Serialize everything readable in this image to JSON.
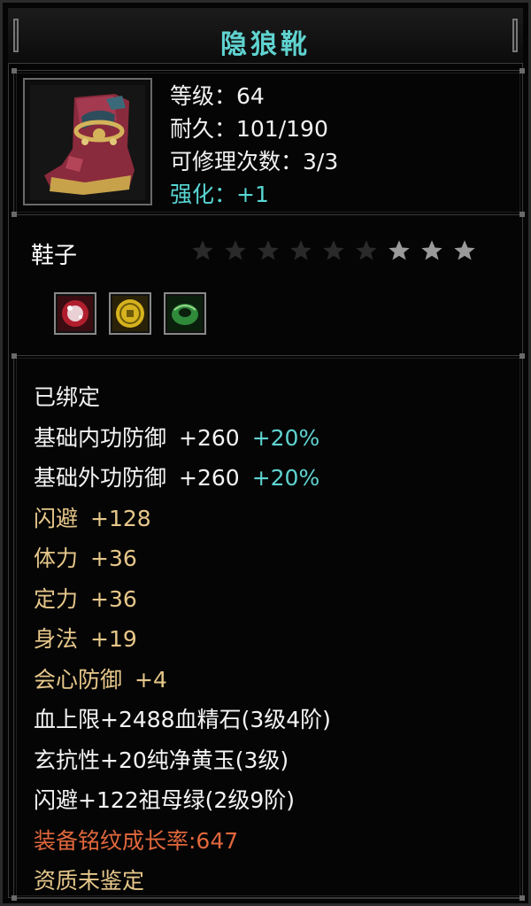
{
  "item": {
    "name": "隐狼靴",
    "level_label": "等级：64",
    "durability_label": "耐久：101/190",
    "repair_label": "可修理次数：3/3",
    "enhance_label": "强化：+1",
    "type": "鞋子",
    "star_rating": {
      "filled": 3,
      "total": 9
    },
    "sockets": [
      "red-gem-icon",
      "gold-coin-icon",
      "green-jade-icon"
    ]
  },
  "attributes": {
    "bound": "已绑定",
    "inner_def": {
      "label": "基础内功防御",
      "value": "+260",
      "bonus": "+20%"
    },
    "outer_def": {
      "label": "基础外功防御",
      "value": "+260",
      "bonus": "+20%"
    },
    "dodge": {
      "label": "闪避",
      "value": "+128"
    },
    "stamina": {
      "label": "体力",
      "value": "+36"
    },
    "focus": {
      "label": "定力",
      "value": "+36"
    },
    "agility": {
      "label": "身法",
      "value": "+19"
    },
    "crit_def": {
      "label": "会心防御",
      "value": "+4"
    },
    "gem1": "血上限+2488血精石(3级4阶)",
    "gem2": "玄抗性+20纯净黄玉(3级)",
    "gem3": "闪避+122祖母绿(2级9阶)",
    "growth": "装备铭纹成长率:647",
    "quality": "资质未鉴定"
  },
  "colors": {
    "title": "#5fd3d0",
    "gold": "#e6c78a",
    "orange": "#e0673c",
    "star_on": "#9a9a9a",
    "star_off": "#2a2a2a"
  }
}
